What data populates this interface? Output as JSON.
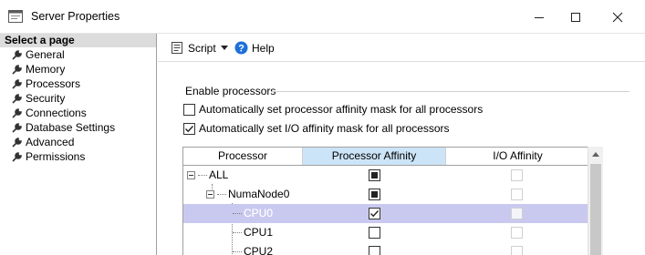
{
  "window": {
    "title": "Server Properties"
  },
  "sidebar": {
    "header": "Select a page",
    "items": [
      {
        "label": "General"
      },
      {
        "label": "Memory"
      },
      {
        "label": "Processors"
      },
      {
        "label": "Security"
      },
      {
        "label": "Connections"
      },
      {
        "label": "Database Settings"
      },
      {
        "label": "Advanced"
      },
      {
        "label": "Permissions"
      }
    ]
  },
  "toolbar": {
    "script_label": "Script",
    "help_label": "Help"
  },
  "content": {
    "group_label": "Enable processors",
    "options": [
      {
        "label": "Automatically set processor affinity mask for all processors",
        "checked": false
      },
      {
        "label": "Automatically set I/O affinity mask for all processors",
        "checked": true
      }
    ],
    "grid": {
      "columns": [
        "Processor",
        "Processor Affinity",
        "I/O Affinity"
      ],
      "rows": [
        {
          "name": "ALL",
          "processor_affinity": "indeterminate",
          "io_affinity": "unchecked-disabled"
        },
        {
          "name": "NumaNode0",
          "processor_affinity": "indeterminate",
          "io_affinity": "unchecked-disabled"
        },
        {
          "name": "CPU0",
          "processor_affinity": "checked",
          "io_affinity": "unchecked-disabled",
          "selected": true
        },
        {
          "name": "CPU1",
          "processor_affinity": "unchecked",
          "io_affinity": "unchecked-disabled"
        },
        {
          "name": "CPU2",
          "processor_affinity": "unchecked",
          "io_affinity": "unchecked-disabled"
        }
      ]
    }
  },
  "colors": {
    "selected_row": "#c9c9f0",
    "header_highlight": "#cce4f7",
    "help_icon": "#1e6fd9"
  }
}
